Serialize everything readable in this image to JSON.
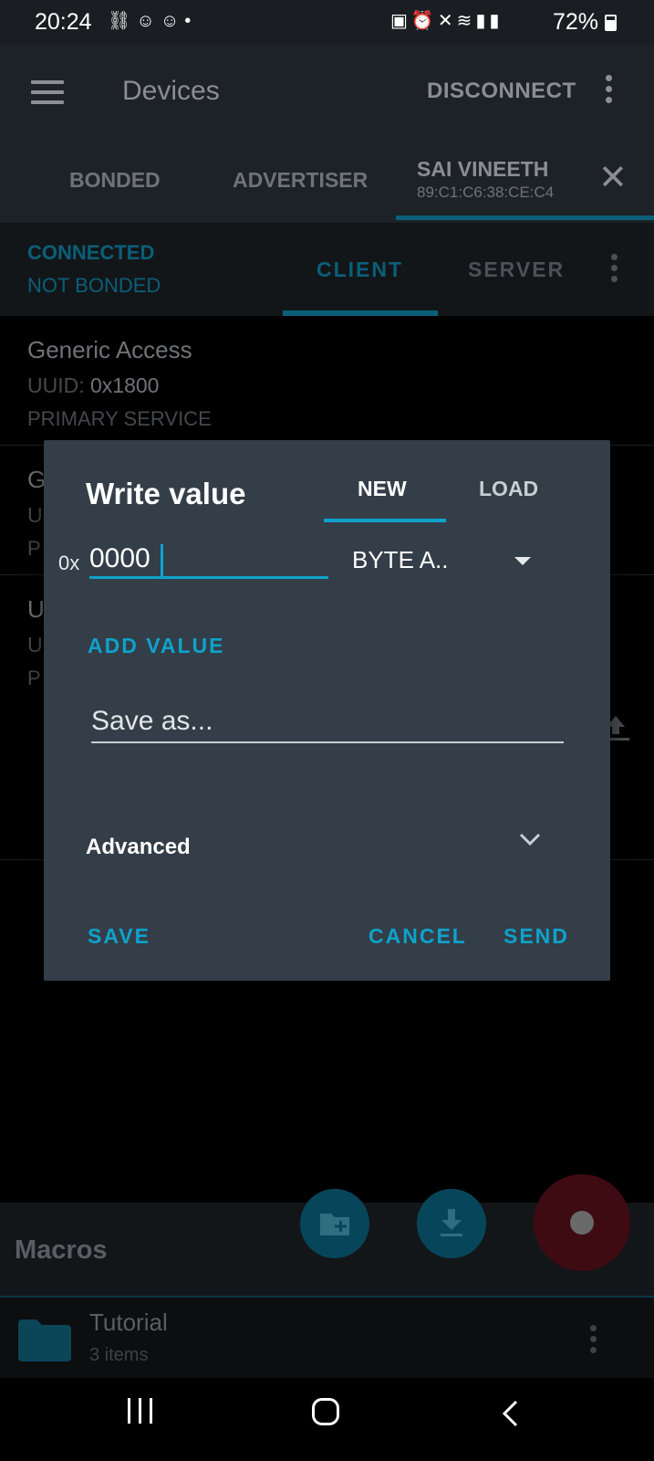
{
  "status_bar": {
    "time": "20:24",
    "left_icons": [
      "link-icon",
      "snapchat-icon",
      "snapchat-icon",
      "notification-dot-icon"
    ],
    "right_icons": [
      "battery-saver-icon",
      "alarm-icon",
      "mute-icon",
      "wifi-icon",
      "signal-icon",
      "signal-icon"
    ],
    "battery": "72%"
  },
  "app_bar": {
    "title": "Devices",
    "disconnect_label": "DISCONNECT"
  },
  "device_tabs": {
    "bonded": "BONDED",
    "advertiser": "ADVERTISER",
    "device_name": "SAI VINEETH",
    "device_mac": "89:C1:C6:38:CE:C4"
  },
  "connection": {
    "status": "CONNECTED",
    "bond": "NOT BONDED",
    "tab_client": "CLIENT",
    "tab_server": "SERVER"
  },
  "services": [
    {
      "name": "Generic Access",
      "uuid_label": "UUID:",
      "uuid": "0x1800",
      "type": "PRIMARY SERVICE"
    },
    {
      "name": "G",
      "uuid_label": "U",
      "uuid": "",
      "type": "P"
    },
    {
      "name": "U",
      "uuid_label": "U",
      "uuid": "",
      "type": "P"
    }
  ],
  "dialog": {
    "title": "Write value",
    "tab_new": "NEW",
    "tab_load": "LOAD",
    "hex_prefix": "0x",
    "hex_value": "0000",
    "format": "BYTE A..",
    "add_value": "ADD VALUE",
    "save_as_placeholder": "Save as...",
    "advanced": "Advanced",
    "save": "SAVE",
    "cancel": "CANCEL",
    "send": "SEND"
  },
  "macros": {
    "title": "Macros",
    "items": [
      {
        "name": "Tutorial",
        "count": "3 items"
      }
    ]
  },
  "colors": {
    "accent": "#0fa2cb",
    "dialog_bg": "#333e48",
    "record": "#3e0b12"
  }
}
